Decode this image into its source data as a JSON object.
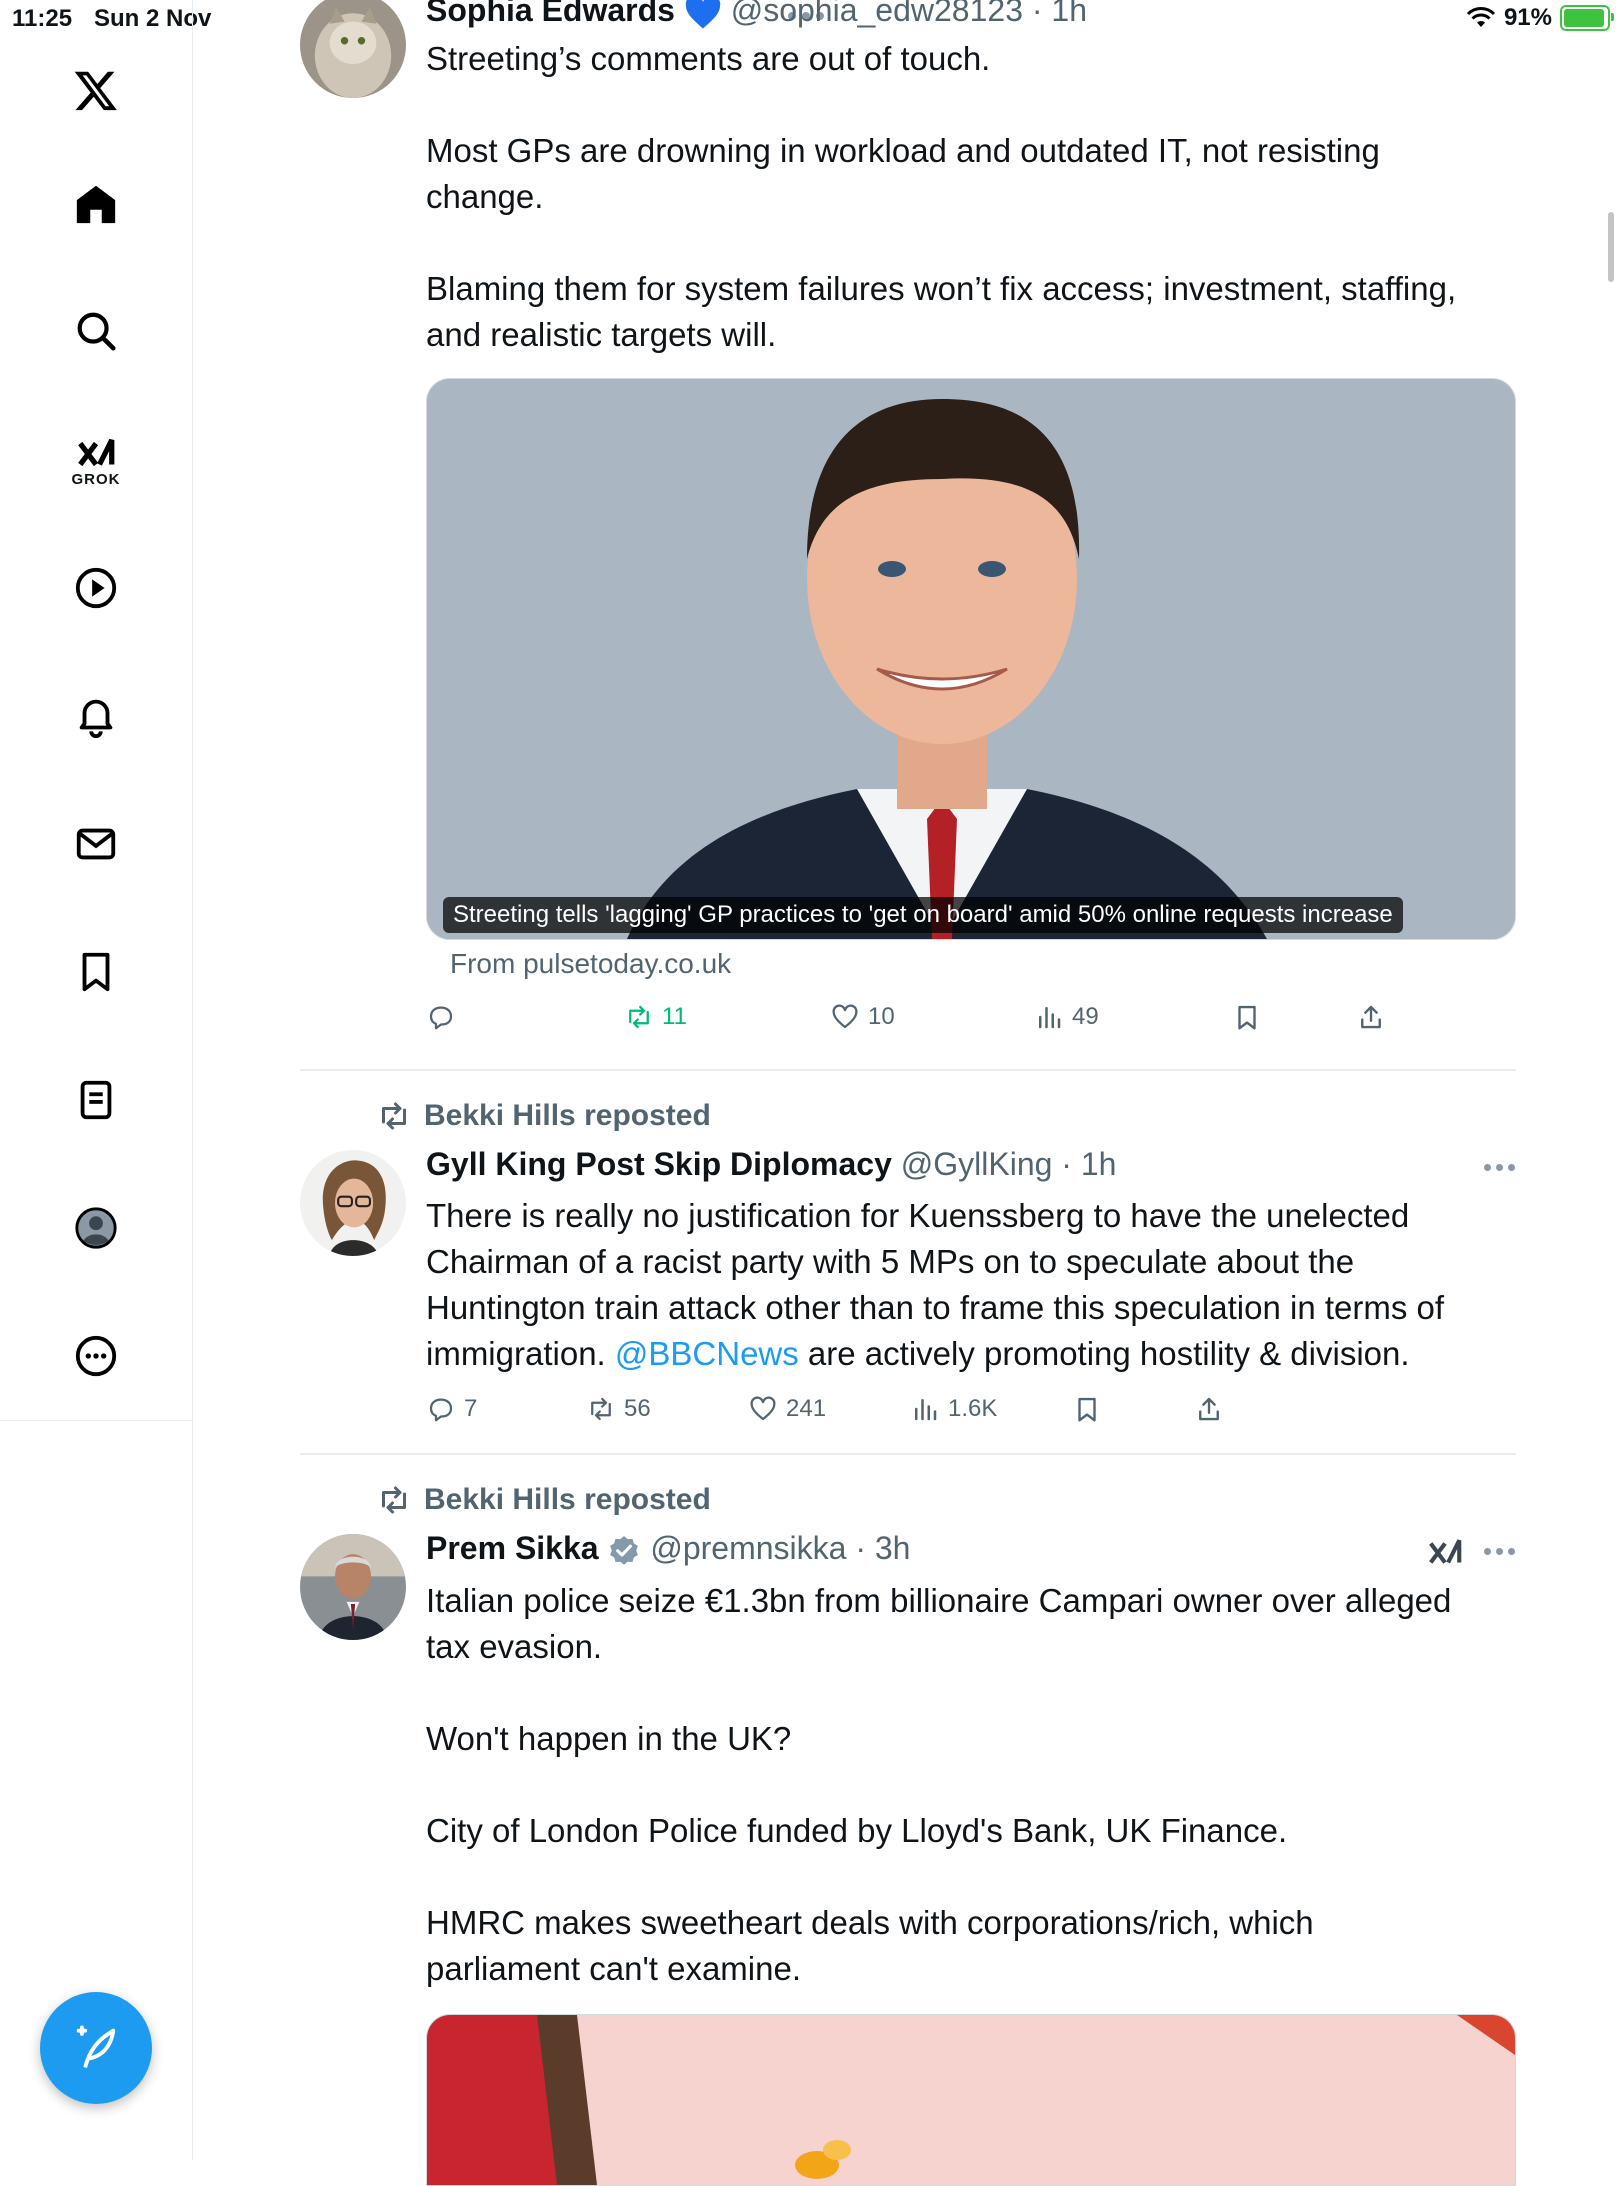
{
  "status_bar": {
    "time": "11:25",
    "date": "Sun 2 Nov",
    "battery_percent": "91%",
    "battery_level": 0.91
  },
  "sidebar": {
    "logo": "x-logo-icon",
    "items": [
      {
        "icon": "home-icon"
      },
      {
        "icon": "search-icon"
      },
      {
        "icon": "grok-icon",
        "label": "GROK"
      },
      {
        "icon": "video-play-icon"
      },
      {
        "icon": "bell-icon"
      },
      {
        "icon": "mail-icon"
      },
      {
        "icon": "bookmark-icon"
      },
      {
        "icon": "lists-icon"
      },
      {
        "icon": "profile-icon"
      },
      {
        "icon": "more-icon"
      }
    ],
    "compose_icon": "compose-icon"
  },
  "tweets": [
    {
      "name": "Sophia Edwards",
      "verified": "blue-heart",
      "handle": "@sophia_edw28123",
      "time": "· 1h",
      "text": "Streeting’s comments are out of touch.\n\nMost GPs are drowning in workload and outdated IT, not resisting\nchange.\n\nBlaming them for system failures won’t fix access; investment, staffing,\nand realistic targets will.",
      "media_caption": "Streeting tells 'lagging' GP practices to 'get on board' amid 50% online requests increase",
      "from": "From pulsetoday.co.uk",
      "replies": "",
      "retweets": "11",
      "likes": "10",
      "views": "49"
    },
    {
      "reposted_by": "Bekki Hills reposted",
      "name": "Gyll King Post Skip Diplomacy",
      "handle": "@GyllKing",
      "time": "· 1h",
      "text_part1": "There is really no justification for Kuenssberg to have the unelected\nChairman of a racist party with 5 MPs on to speculate about the\nHuntington train attack other than to frame this speculation in terms of\nimmigration. ",
      "mention": "@BBCNews",
      "text_part2": " are actively promoting hostility & division.",
      "replies": "7",
      "retweets": "56",
      "likes": "241",
      "views": "1.6K"
    },
    {
      "reposted_by": "Bekki Hills reposted",
      "name": "Prem Sikka",
      "verified": "gray-check",
      "handle": "@premnsikka",
      "time": "· 3h",
      "text": "Italian police seize €1.3bn from billionaire Campari owner over alleged\ntax evasion.\n\nWon't happen in the UK?\n\nCity of London Police funded by Lloyd's Bank, UK Finance.\n\nHMRC makes sweetheart deals with corporations/rich, which\nparliament can't examine."
    }
  ],
  "colors": {
    "accent": "#1d9bf0",
    "retweet_active": "#00ba7c",
    "secondary_text": "#536471",
    "divider": "#e6ecf0"
  }
}
